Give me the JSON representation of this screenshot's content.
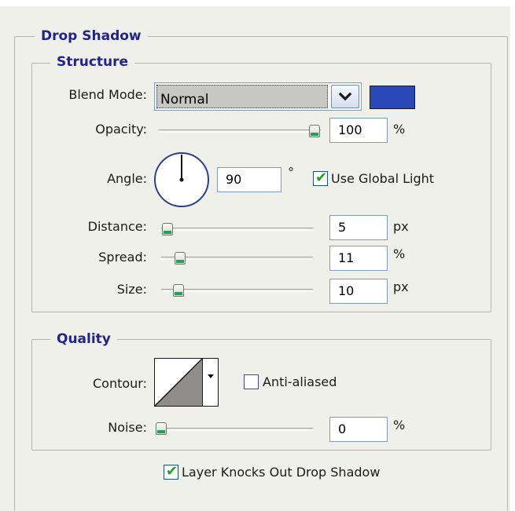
{
  "drop_shadow": {
    "title": "Drop Shadow",
    "structure": {
      "title": "Structure",
      "blend_mode_label": "Blend Mode:",
      "blend_mode_value": "Normal",
      "shadow_color": "#2a48b8",
      "opacity_label": "Opacity:",
      "opacity_value": "100",
      "opacity_unit": "%",
      "opacity_fraction": 1.0,
      "angle_label": "Angle:",
      "angle_value": "90",
      "angle_unit": "°",
      "use_global_light_label": "Use Global Light",
      "use_global_light_checked": true,
      "distance_label": "Distance:",
      "distance_value": "5",
      "distance_unit": "px",
      "spread_label": "Spread:",
      "spread_value": "11",
      "spread_unit": "%",
      "size_label": "Size:",
      "size_value": "10",
      "size_unit": "px"
    },
    "quality": {
      "title": "Quality",
      "contour_label": "Contour:",
      "anti_aliased_label": "Anti-aliased",
      "anti_aliased_checked": false,
      "noise_label": "Noise:",
      "noise_value": "0",
      "noise_unit": "%"
    },
    "layer_knocks_out_label": "Layer Knocks Out Drop Shadow",
    "layer_knocks_out_checked": true
  },
  "icons": {
    "dropdown": "chevron-down-icon",
    "contour_dropdown": "caret-down-icon",
    "angle_dial": "angle-dial-icon",
    "check": "checkmark-icon"
  },
  "colors": {
    "title_text": "#23238c",
    "check": "#21a121",
    "slider_thumb_accent": "#21a05a"
  }
}
